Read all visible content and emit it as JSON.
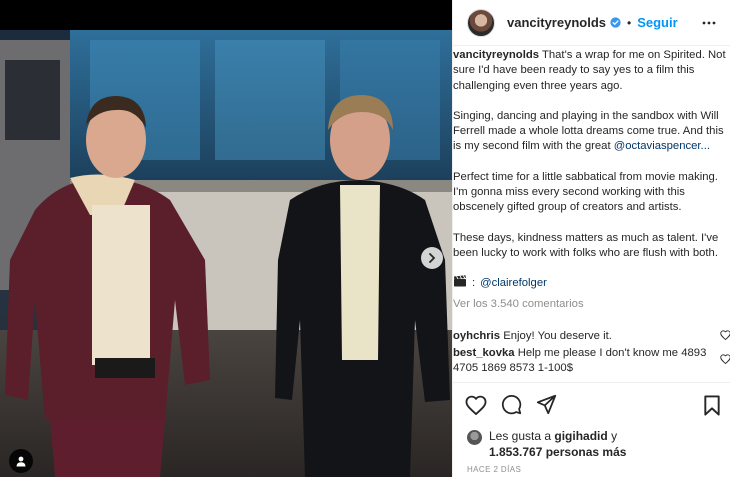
{
  "post": {
    "username": "vancityreynolds",
    "follow_label": "Seguir",
    "separator": "•"
  },
  "caption": {
    "author": "vancityreynolds",
    "paragraph1": "That's a wrap for me on Spirited. Not sure I'd have been ready to say yes to a film this challenging even three years ago.",
    "paragraph2": "Singing, dancing and playing in the sandbox with Will Ferrell made a whole lotta dreams come true. And this is my second film with the great",
    "paragraph2_mention": "@octaviaspencer...",
    "paragraph3": "Perfect time for a little sabbatical from movie making. I'm gonna miss every second working with this obscenely gifted group of creators and artists.",
    "paragraph4": "These days, kindness matters as much as talent. I've been lucky to work with folks who are flush with both.",
    "credit_mention": "@clairefolger",
    "view_comments": "Ver los 3.540 comentarios"
  },
  "comments": [
    {
      "user": "oyhchris",
      "text": "Enjoy! You deserve it."
    },
    {
      "user": "best_kovka",
      "text": "Help me please I don't know me 4893 4705 1869 8573 1-100$"
    }
  ],
  "likes": {
    "prefix": "Les gusta a",
    "user": "gigihadid",
    "connector": "y",
    "count": "1.853.767 personas más"
  },
  "date": "HACE 2 DÍAS",
  "icons": {
    "verified": "verified-badge-icon",
    "more": "more-options-icon",
    "heart": "heart-icon",
    "comment": "comment-icon",
    "share": "share-icon",
    "save": "bookmark-icon",
    "clapper": "clapperboard-icon",
    "next": "chevron-right-icon",
    "tag": "user-tag-icon"
  },
  "colors": {
    "accent": "#0095f6",
    "text": "#262626",
    "muted": "#8e8e8e",
    "mention": "#00376b"
  }
}
